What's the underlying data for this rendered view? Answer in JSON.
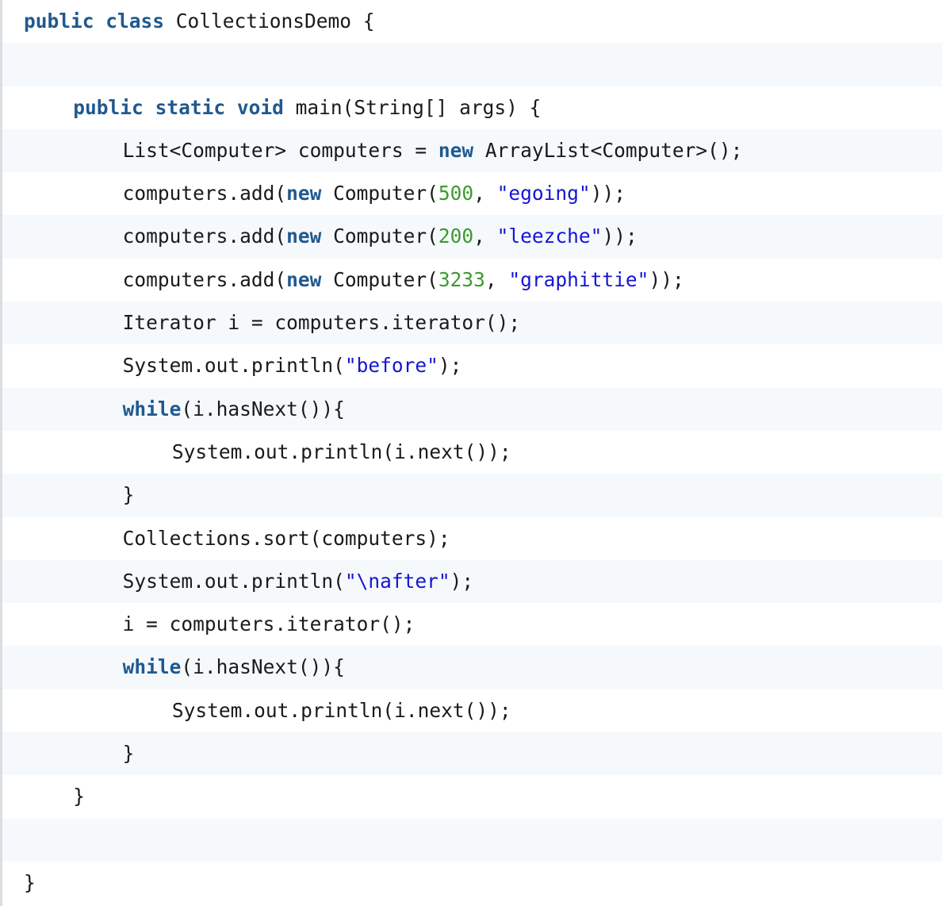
{
  "code": {
    "language": "java",
    "lines": [
      {
        "indent": 0,
        "tokens": [
          {
            "t": "kw",
            "v": "public"
          },
          {
            "t": "plain",
            "v": " "
          },
          {
            "t": "kw",
            "v": "class"
          },
          {
            "t": "plain",
            "v": " CollectionsDemo {"
          }
        ]
      },
      {
        "indent": 0,
        "tokens": []
      },
      {
        "indent": 1,
        "tokens": [
          {
            "t": "kw",
            "v": "public"
          },
          {
            "t": "plain",
            "v": " "
          },
          {
            "t": "kw",
            "v": "static"
          },
          {
            "t": "plain",
            "v": " "
          },
          {
            "t": "kw",
            "v": "void"
          },
          {
            "t": "plain",
            "v": " main(String[] args) {"
          }
        ]
      },
      {
        "indent": 2,
        "tokens": [
          {
            "t": "plain",
            "v": "List<Computer> computers = "
          },
          {
            "t": "kw",
            "v": "new"
          },
          {
            "t": "plain",
            "v": " ArrayList<Computer>();"
          }
        ]
      },
      {
        "indent": 2,
        "tokens": [
          {
            "t": "plain",
            "v": "computers.add("
          },
          {
            "t": "kw",
            "v": "new"
          },
          {
            "t": "plain",
            "v": " Computer("
          },
          {
            "t": "num",
            "v": "500"
          },
          {
            "t": "plain",
            "v": ", "
          },
          {
            "t": "str",
            "v": "\"egoing\""
          },
          {
            "t": "plain",
            "v": "));"
          }
        ]
      },
      {
        "indent": 2,
        "tokens": [
          {
            "t": "plain",
            "v": "computers.add("
          },
          {
            "t": "kw",
            "v": "new"
          },
          {
            "t": "plain",
            "v": " Computer("
          },
          {
            "t": "num",
            "v": "200"
          },
          {
            "t": "plain",
            "v": ", "
          },
          {
            "t": "str",
            "v": "\"leezche\""
          },
          {
            "t": "plain",
            "v": "));"
          }
        ]
      },
      {
        "indent": 2,
        "tokens": [
          {
            "t": "plain",
            "v": "computers.add("
          },
          {
            "t": "kw",
            "v": "new"
          },
          {
            "t": "plain",
            "v": " Computer("
          },
          {
            "t": "num",
            "v": "3233"
          },
          {
            "t": "plain",
            "v": ", "
          },
          {
            "t": "str",
            "v": "\"graphittie\""
          },
          {
            "t": "plain",
            "v": "));"
          }
        ]
      },
      {
        "indent": 2,
        "tokens": [
          {
            "t": "plain",
            "v": "Iterator i = computers.iterator();"
          }
        ]
      },
      {
        "indent": 2,
        "tokens": [
          {
            "t": "plain",
            "v": "System.out.println("
          },
          {
            "t": "str",
            "v": "\"before\""
          },
          {
            "t": "plain",
            "v": ");"
          }
        ]
      },
      {
        "indent": 2,
        "tokens": [
          {
            "t": "kw",
            "v": "while"
          },
          {
            "t": "plain",
            "v": "(i.hasNext()){"
          }
        ]
      },
      {
        "indent": 3,
        "tokens": [
          {
            "t": "plain",
            "v": "System.out.println(i.next());"
          }
        ]
      },
      {
        "indent": 2,
        "tokens": [
          {
            "t": "plain",
            "v": "}"
          }
        ]
      },
      {
        "indent": 2,
        "tokens": [
          {
            "t": "plain",
            "v": "Collections.sort(computers);"
          }
        ]
      },
      {
        "indent": 2,
        "tokens": [
          {
            "t": "plain",
            "v": "System.out.println("
          },
          {
            "t": "str",
            "v": "\"\\nafter\""
          },
          {
            "t": "plain",
            "v": ");"
          }
        ]
      },
      {
        "indent": 2,
        "tokens": [
          {
            "t": "plain",
            "v": "i = computers.iterator();"
          }
        ]
      },
      {
        "indent": 2,
        "tokens": [
          {
            "t": "kw",
            "v": "while"
          },
          {
            "t": "plain",
            "v": "(i.hasNext()){"
          }
        ]
      },
      {
        "indent": 3,
        "tokens": [
          {
            "t": "plain",
            "v": "System.out.println(i.next());"
          }
        ]
      },
      {
        "indent": 2,
        "tokens": [
          {
            "t": "plain",
            "v": "}"
          }
        ]
      },
      {
        "indent": 1,
        "tokens": [
          {
            "t": "plain",
            "v": "}"
          }
        ]
      },
      {
        "indent": 0,
        "tokens": []
      },
      {
        "indent": 0,
        "tokens": [
          {
            "t": "plain",
            "v": "}"
          }
        ]
      }
    ]
  },
  "colors": {
    "keyword": "#20598f",
    "number": "#3c9b2f",
    "string": "#1515d4",
    "text": "#1a1a1a",
    "stripe": "#f5f9fc",
    "gutter_border": "#d9dee3"
  }
}
